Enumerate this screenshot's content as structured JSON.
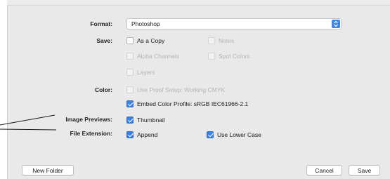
{
  "form": {
    "format": {
      "label": "Format:",
      "value": "Photoshop",
      "arrows_icon": "updown-chevron-icon"
    },
    "save": {
      "label": "Save:",
      "options": [
        {
          "label": "As a Copy",
          "checked": false,
          "disabled": false
        },
        {
          "label": "Notes",
          "checked": false,
          "disabled": true
        },
        {
          "label": "Alpha Channels",
          "checked": false,
          "disabled": true
        },
        {
          "label": "Spot Colors",
          "checked": false,
          "disabled": true
        },
        {
          "label": "Layers",
          "checked": false,
          "disabled": true
        }
      ]
    },
    "color": {
      "label": "Color:",
      "proof_setup": {
        "label": "Use Proof Setup:  Working CMYK",
        "checked": false,
        "disabled": true
      },
      "embed_profile": {
        "label": "Embed Color Profile:  sRGB IEC61966-2.1",
        "checked": true,
        "disabled": false
      }
    },
    "image_previews": {
      "label": "Image Previews:",
      "thumbnail": {
        "label": "Thumbnail",
        "checked": true
      }
    },
    "file_extension": {
      "label": "File Extension:",
      "append": {
        "label": "Append",
        "checked": true
      },
      "lower_case": {
        "label": "Use Lower Case",
        "checked": true
      }
    }
  },
  "buttons": {
    "new_folder": "New Folder",
    "cancel": "Cancel",
    "save": "Save"
  },
  "colors": {
    "panel_bg": "#e9e9e9",
    "accent": "#3b82e0",
    "callout_line": "#1a1a1a"
  }
}
